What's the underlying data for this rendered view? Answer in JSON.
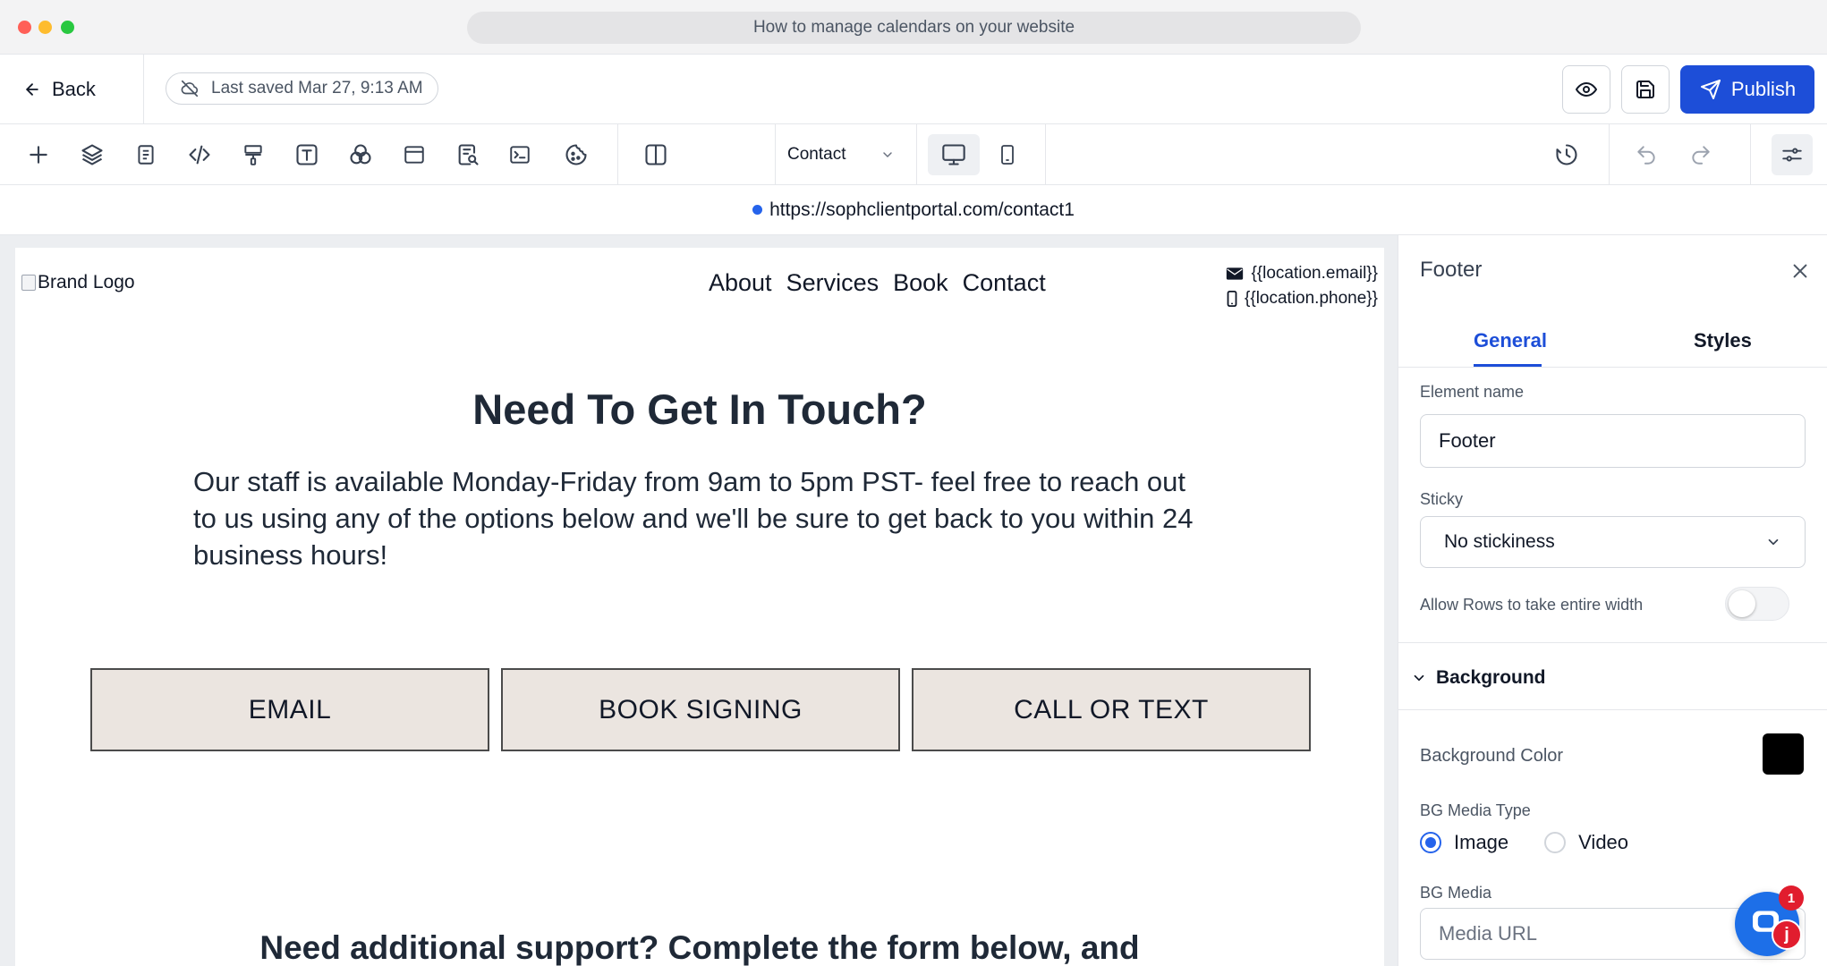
{
  "window": {
    "title": "How to manage calendars on your website"
  },
  "header": {
    "back_label": "Back",
    "last_saved": "Last saved Mar 27, 9:13 AM",
    "publish_label": "Publish",
    "accent_color": "#1d4ed8"
  },
  "toolbar": {
    "tools": [
      "add-icon",
      "layers-icon",
      "pages-icon",
      "code-icon",
      "paint-roller-icon",
      "text-icon",
      "color-blend-icon",
      "section-icon",
      "page-search-icon",
      "terminal-icon",
      "cookie-icon",
      "split-view-icon"
    ],
    "page_select": "Contact",
    "devices": [
      "desktop-icon",
      "mobile-icon"
    ],
    "right_tools": [
      "history-icon",
      "undo-icon",
      "redo-icon",
      "settings-sliders-icon"
    ]
  },
  "urlbar": {
    "url": "https://sophclientportal.com/contact1"
  },
  "canvas": {
    "brand_logo_alt": "Brand Logo",
    "nav": [
      "About",
      "Services",
      "Book",
      "Contact"
    ],
    "contact_email": "{{location.email}}",
    "contact_phone": "{{location.phone}}",
    "headline": "Need To Get In Touch?",
    "paragraph": "Our staff is available Monday-Friday from 9am to 5pm PST- feel free to reach out to us using any of the options below and we'll be sure to get back to you within 24 business hours!",
    "buttons": [
      "EMAIL",
      "BOOK SIGNING",
      "CALL OR TEXT"
    ],
    "button_bg": "#ebe5e0",
    "subheadline": "Need additional support? Complete the form below, and"
  },
  "panel": {
    "title": "Footer",
    "tabs": [
      "General",
      "Styles"
    ],
    "active_tab": "General",
    "element_name_label": "Element name",
    "element_name_value": "Footer",
    "sticky_label": "Sticky",
    "sticky_value": "No stickiness",
    "allow_rows_label": "Allow Rows to take entire width",
    "allow_rows_enabled": false,
    "background_section": "Background",
    "bg_color_label": "Background Color",
    "bg_color_value": "#000000",
    "bg_media_type_label": "BG Media Type",
    "bg_media_options": [
      "Image",
      "Video"
    ],
    "bg_media_selected": "Image",
    "bg_media_label": "BG Media",
    "bg_media_placeholder": "Media URL"
  },
  "chat": {
    "badge_count": "1",
    "avatar_letter": "j"
  }
}
